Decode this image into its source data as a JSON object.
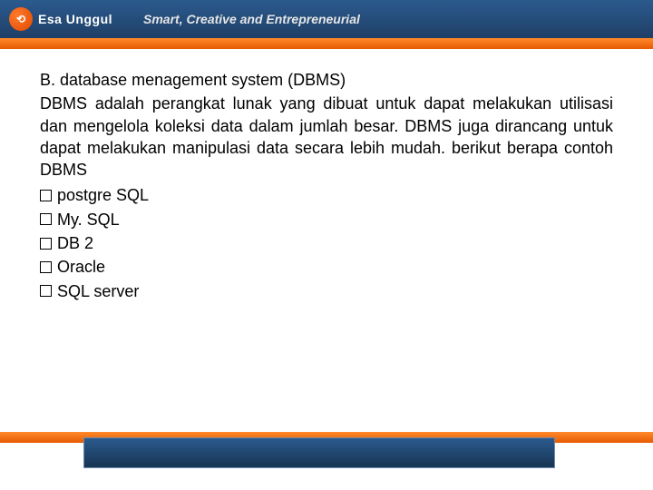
{
  "header": {
    "logo_glyph": "⟲",
    "logo_text": "Esa Unggul",
    "tagline": "Smart, Creative and Entrepreneurial"
  },
  "content": {
    "heading": "B. database menagement system (DBMS)",
    "paragraph": "DBMS adalah perangkat lunak yang dibuat untuk dapat melakukan utilisasi dan mengelola koleksi data dalam jumlah besar. DBMS juga dirancang untuk dapat melakukan manipulasi data secara lebih mudah. berikut berapa contoh DBMS",
    "items": [
      "postgre SQL",
      "My. SQL",
      "DB 2",
      "Oracle",
      "SQL server"
    ]
  }
}
